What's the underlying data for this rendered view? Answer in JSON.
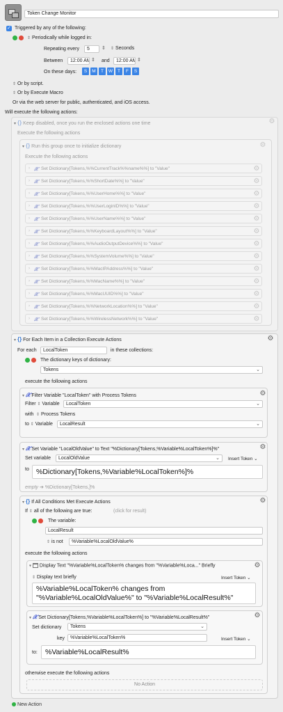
{
  "macro": {
    "name": "Token Change Monitor",
    "triggered_label": "Triggered by any of the following:",
    "periodic_label": "Periodically while logged in:",
    "repeating_label": "Repeating every",
    "repeat_value": "5",
    "repeat_unit": "Seconds",
    "between_label": "Between",
    "start_time": "12:00 AM",
    "and_label": "and",
    "end_time": "12:00 AM",
    "days_label": "On these days:",
    "days": [
      "S",
      "M",
      "T",
      "W",
      "T",
      "F",
      "S"
    ],
    "or_script": "Or by script.",
    "or_execute": "Or by Execute Macro",
    "or_web": "Or via the web server for public, authenticated, and iOS access.",
    "will_execute": "Will execute the following actions:",
    "new_action": "New Action"
  },
  "keep_disabled": {
    "title": "Keep disabled, once you run the enclosed actions one time",
    "exec_label": "Execute the following actions",
    "run_once_title": "Run this group once to initialize dictionary",
    "inner_exec_label": "Execute the following actions",
    "rows": [
      "Set Dictionary[Tokens,%%CurrentTrack%%name%%] to \"Value\"",
      "Set Dictionary[Tokens,%%ShortDate%%] to \"Value\"",
      "Set Dictionary[Tokens,%%UserHome%%] to \"Value\"",
      "Set Dictionary[Tokens,%%UserLoginID%%] to \"Value\"",
      "Set Dictionary[Tokens,%%UserName%%] to \"Value\"",
      "Set Dictionary[Tokens,%%KeyboardLayout%%] to \"Value\"",
      "Set Dictionary[Tokens,%%AudioOutputDevice%%] to \"Value\"",
      "Set Dictionary[Tokens,%%SystemVolume%%] to \"Value\"",
      "Set Dictionary[Tokens,%%MacIPAddress%%] to \"Value\"",
      "Set Dictionary[Tokens,%%MacName%%] to \"Value\"",
      "Set Dictionary[Tokens,%%MacUUID%%] to \"Value\"",
      "Set Dictionary[Tokens,%%NetworkLocation%%] to \"Value\"",
      "Set Dictionary[Tokens,%%WirelessNetwork%%] to \"Value\""
    ]
  },
  "for_each": {
    "title": "For Each Item in a Collection Execute Actions",
    "for_each_label": "For each",
    "variable": "LocalToken",
    "in_collections": "in these collections:",
    "collection_type": "The dictionary keys of dictionary:",
    "dictionary": "Tokens",
    "exec_label": "execute the following actions"
  },
  "filter": {
    "title": "Filter Variable \"LocalToken\" with Process Tokens",
    "filter_label": "Filter",
    "variable_word": "Variable",
    "variable": "LocalToken",
    "with_label": "with",
    "process": "Process Tokens",
    "to_label": "to",
    "to_variable_word": "Variable",
    "result": "LocalResult"
  },
  "set_var": {
    "title": "Set Variable \"LocalOldValue\" to Text \"%Dictionary[Tokens,%Variable%LocalToken%]%\"",
    "set_label": "Set variable",
    "variable": "LocalOldValue",
    "insert_token": "Insert Token",
    "to_label": "to",
    "value": "%Dictionary[Tokens,%Variable%LocalToken%]%",
    "preview_empty": "empty",
    "preview_text": "%Dictionary[Tokens,]%"
  },
  "if_all": {
    "title": "If All Conditions Met Execute Actions",
    "if_label": "If",
    "mode": "all of the following are true:",
    "click_hint": "(click for result)",
    "condition_label": "The variable:",
    "variable": "LocalResult",
    "operator": "is not",
    "compare": "%Variable%LocalOldValue%",
    "exec_label": "execute the following actions",
    "otherwise_label": "otherwise execute the following actions",
    "no_action": "No Action"
  },
  "display": {
    "title": "Display Text \"%Variable%LocalToken% changes from \"%Variable%Loca...\" Briefly",
    "mode": "Display text briefly",
    "insert_token": "Insert Token",
    "line1": "%Variable%LocalToken% changes from",
    "line2": "\"%Variable%LocalOldValue%\" to \"%Variable%LocalResult%\""
  },
  "set_dict": {
    "title": "Set Dictionary[Tokens,%Variable%LocalToken%] to \"%Variable%LocalResult%\"",
    "dict_label": "Set dictionary",
    "dictionary": "Tokens",
    "key_label": "key",
    "key": "%Variable%LocalToken%",
    "insert_token": "Insert Token",
    "to_label": "to:",
    "value": "%Variable%LocalResult%"
  },
  "colors": {
    "accent": "#3a84e6",
    "green": "#2fb344",
    "red": "#e04a3a"
  }
}
